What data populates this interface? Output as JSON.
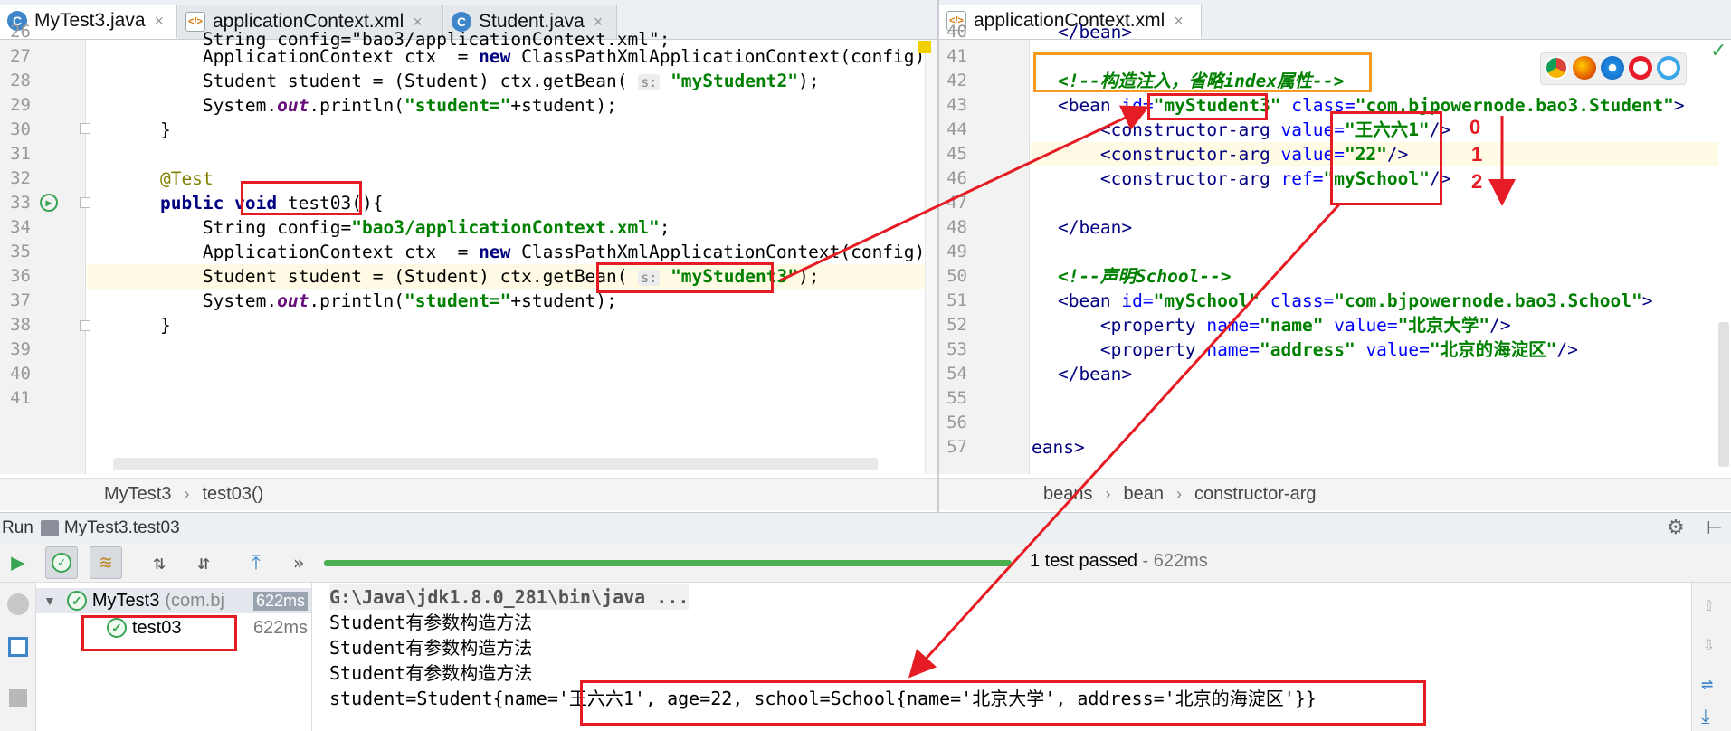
{
  "left_tabs": [
    {
      "label": "MyTest3.java",
      "icon": "class-icon"
    },
    {
      "label": "applicationContext.xml",
      "icon": "xml-file-icon"
    },
    {
      "label": "Student.java",
      "icon": "class-icon"
    }
  ],
  "right_tab": {
    "label": "applicationContext.xml",
    "icon": "xml-file-icon"
  },
  "left_editor": {
    "line_numbers": [
      "26",
      "27",
      "28",
      "29",
      "30",
      "31",
      "32",
      "33",
      "34",
      "35",
      "36",
      "37",
      "38",
      "39",
      "40",
      "41"
    ],
    "line26_text": "        String config=\"bao3/applicationContext.xml\";",
    "line27_a": "        ApplicationContext ctx  = ",
    "line27_kw": "new",
    "line27_b": " ClassPathXmlApplicationContext(config);",
    "line28_a": "        Student student = (Student) ctx.getBean( ",
    "line28_hint": "s:",
    "line28_str": " \"myStudent2\"",
    "line28_b": ");",
    "line29_a": "        System.",
    "line29_fld": "out",
    "line29_b": ".println(",
    "line29_str": "\"student=\"",
    "line29_c": "+student);",
    "line30": "    }",
    "line32_ann": "    @Test",
    "line33_kw1": "    public",
    "line33_kw2": " void",
    "line33_b": " test03(){",
    "line34_a": "        String config=",
    "line34_str": "\"bao3/applicationContext.xml\"",
    "line34_b": ";",
    "line35_a": "        ApplicationContext ctx  = ",
    "line35_kw": "new",
    "line35_b": " ClassPathXmlApplicationContext(config);",
    "line36_a": "        Student student = (Student) ctx.getBean( ",
    "line36_hint": "s:",
    "line36_str": " \"myStudent3\"",
    "line36_b": ");",
    "line37_a": "        System.",
    "line37_fld": "out",
    "line37_b": ".println(",
    "line37_str": "\"student=\"",
    "line37_c": "+student);",
    "line38": "    }"
  },
  "left_breadcrumb": [
    "MyTest3",
    "test03()"
  ],
  "right_editor": {
    "line_numbers": [
      "40",
      "41",
      "42",
      "43",
      "44",
      "45",
      "46",
      "47",
      "48",
      "49",
      "50",
      "51",
      "52",
      "53",
      "54",
      "55",
      "56",
      "57"
    ],
    "line40": "    </bean>",
    "line42_comment": "    <!--构造注入，省略index属性-->",
    "line43_t1": "    <bean ",
    "line43_a1": "id=",
    "line43_v1": "\"myStudent3\"",
    "line43_a2": " class=",
    "line43_v2": "\"com.bjpowernode.bao3.Student\"",
    "line43_t2": ">",
    "line44_t1": "        <constructor-arg ",
    "line44_a1": "value=",
    "line44_v1": "\"王六六1\"",
    "line44_t2": "/>",
    "line45_t1": "        <constructor-arg ",
    "line45_a1": "value=",
    "line45_v1": "\"22\"",
    "line45_t2": "/>",
    "line46_t1": "        <constructor-arg ",
    "line46_a1": "ref=",
    "line46_v1": "\"mySchool\"",
    "line46_t2": "/>",
    "line48": "    </bean>",
    "line50_comment": "    <!--声明School-->",
    "line51_t1": "    <bean ",
    "line51_a1": "id=",
    "line51_v1": "\"mySchool\"",
    "line51_a2": " class=",
    "line51_v2": "\"com.bjpowernode.bao3.School\"",
    "line51_t2": ">",
    "line52_t1": "        <property ",
    "line52_a1": "name=",
    "line52_v1": "\"name\"",
    "line52_a2": " value=",
    "line52_v2": "\"北京大学\"",
    "line52_t2": "/>",
    "line53_t1": "        <property ",
    "line53_a1": "name=",
    "line53_v1": "\"address\"",
    "line53_a2": " value=",
    "line53_v2": "\"北京的海淀区\"",
    "line53_t2": "/>",
    "line54": "    </bean>",
    "line57": "eans>"
  },
  "right_breadcrumb": [
    "beans",
    "bean",
    "constructor-arg"
  ],
  "index_annotations": [
    "0",
    "1",
    "2"
  ],
  "run": {
    "label": "Run",
    "config_name": "MyTest3.test03",
    "status": "1 test passed",
    "duration": " - 622ms",
    "tree_root": "MyTest3",
    "tree_root_pkg": "(com.bj",
    "tree_root_time": "622ms",
    "tree_child": "test03",
    "tree_child_time": "622ms",
    "console": [
      "G:\\Java\\jdk1.8.0_281\\bin\\java ...",
      "Student有参数构造方法",
      "Student有参数构造方法",
      "Student有参数构造方法",
      "student=Student{name='王六六1', age=22, school=School{name='北京大学', address='北京的海淀区'}}"
    ]
  },
  "colors": {
    "accent_red": "#e51c23",
    "accent_orange": "#f59a23",
    "pass_green": "#3aa655"
  }
}
